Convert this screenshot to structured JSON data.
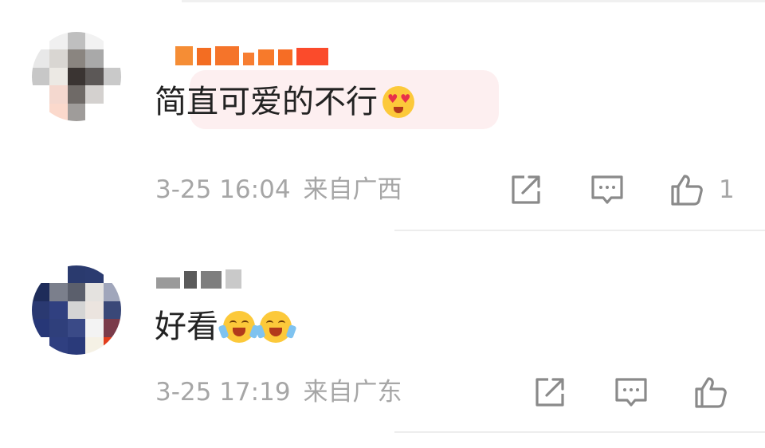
{
  "comments": [
    {
      "text": "简直可爱的不行",
      "timestamp": "3-25 16:04",
      "location": "来自广西",
      "likes": "1",
      "emojis": [
        "heart-eyes-emoji"
      ],
      "highlighted": true,
      "avatar_colors": [
        "#ffffff",
        "#f0f0f0",
        "#bfbfbf",
        "#f2f2f2",
        "#ffffff",
        "#e8e8e8",
        "#d9d6d2",
        "#8a8580",
        "#a9a9a9",
        "#ffffff",
        "#c7c7c7",
        "#ece9e4",
        "#3a3432",
        "#5c5857",
        "#c9c9c9",
        "#ffffff",
        "#f4d8cf",
        "#6f6a67",
        "#d4d1cf",
        "#ffffff",
        "#ffffff",
        "#fbd9cc",
        "#9f9c9a",
        "#ffffff",
        "#ffffff"
      ],
      "name_blocks": [
        "#f58d35",
        "#f36d22",
        "#f5742a",
        "#f77e32",
        "#f77a2b",
        "#f66d25",
        "#fb4b2b"
      ]
    },
    {
      "text": "好看",
      "timestamp": "3-25 17:19",
      "location": "来自广东",
      "likes": "",
      "emojis": [
        "laughing-emoji",
        "laughing-emoji"
      ],
      "highlighted": false,
      "avatar_colors": [
        "#ffffff",
        "#ffffff",
        "#2a3a6e",
        "#2b3b70",
        "#ffffff",
        "#1e2c5a",
        "#7b7f8c",
        "#5b5f6c",
        "#e4e2df",
        "#a0a6bb",
        "#2a3971",
        "#304080",
        "#d4d4d4",
        "#ebe4df",
        "#3a4878",
        "#273777",
        "#2f3f7b",
        "#3a4a87",
        "#f3f3f3",
        "#7a3b4a",
        "#ffffff",
        "#2f3f80",
        "#2a3a7a",
        "#f5f1e5",
        "#e23d1c"
      ],
      "name_blocks": [
        "#9a9a9a",
        "#5a5a5a",
        "#7e7e7e",
        "#c9c9c9"
      ]
    }
  ],
  "icons": {
    "share": "share-icon",
    "comment": "comment-icon",
    "like": "thumbs-up-icon"
  }
}
